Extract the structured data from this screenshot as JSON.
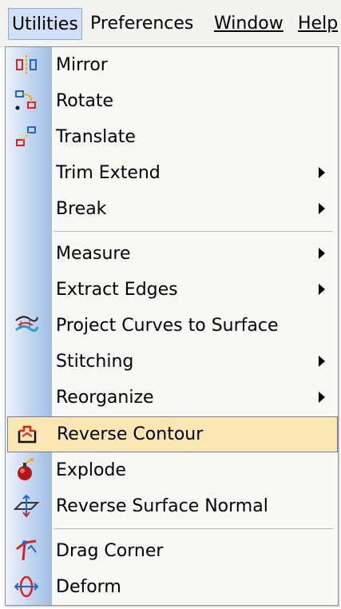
{
  "menubar": {
    "items": [
      {
        "label": "Utilities",
        "active": true
      },
      {
        "label": "Preferences"
      },
      {
        "label": "Window"
      },
      {
        "label": "Help"
      }
    ]
  },
  "menu": {
    "items": [
      {
        "label": "Mirror",
        "icon": "mirror-icon"
      },
      {
        "label": "Rotate",
        "icon": "rotate-icon"
      },
      {
        "label": "Translate",
        "icon": "translate-icon"
      },
      {
        "label": "Trim Extend",
        "submenu": true
      },
      {
        "label": "Break",
        "submenu": true
      },
      {
        "label": "Measure",
        "submenu": true
      },
      {
        "label": "Extract Edges",
        "submenu": true
      },
      {
        "label": "Project Curves to Surface",
        "icon": "project-curves-icon"
      },
      {
        "label": "Stitching",
        "submenu": true
      },
      {
        "label": "Reorganize",
        "submenu": true
      },
      {
        "label": "Reverse Contour",
        "icon": "reverse-contour-icon",
        "highlighted": true
      },
      {
        "label": "Explode",
        "icon": "explode-icon"
      },
      {
        "label": "Reverse Surface Normal",
        "icon": "reverse-normal-icon"
      },
      {
        "label": "Drag Corner",
        "icon": "drag-corner-icon"
      },
      {
        "label": "Deform",
        "icon": "deform-icon"
      }
    ]
  },
  "colors": {
    "highlight": "#fbe7b3",
    "active_menubar": "#cfdff5",
    "icon_strip": "#9fbde6"
  }
}
